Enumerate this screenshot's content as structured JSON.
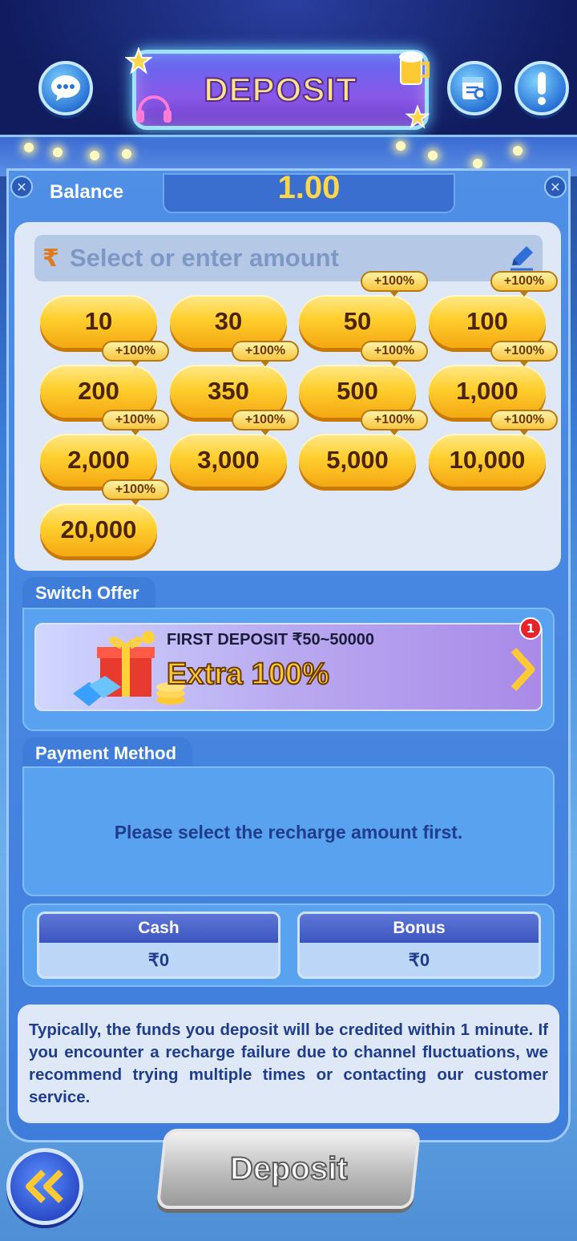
{
  "header": {
    "title": "DEPOSIT",
    "support_icon": "chat-support-icon",
    "records_icon": "records-search-icon",
    "info_icon": "exclamation-icon"
  },
  "balance": {
    "label": "Balance",
    "value": "1.00"
  },
  "amount_input": {
    "currency_symbol": "₹",
    "placeholder": "Select or enter amount"
  },
  "amounts": [
    {
      "label": "10",
      "badge": ""
    },
    {
      "label": "30",
      "badge": ""
    },
    {
      "label": "50",
      "badge": "+100%"
    },
    {
      "label": "100",
      "badge": "+100%"
    },
    {
      "label": "200",
      "badge": "+100%"
    },
    {
      "label": "350",
      "badge": "+100%"
    },
    {
      "label": "500",
      "badge": "+100%"
    },
    {
      "label": "1,000",
      "badge": "+100%"
    },
    {
      "label": "2,000",
      "badge": "+100%"
    },
    {
      "label": "3,000",
      "badge": "+100%"
    },
    {
      "label": "5,000",
      "badge": "+100%"
    },
    {
      "label": "10,000",
      "badge": "+100%"
    },
    {
      "label": "20,000",
      "badge": "+100%"
    }
  ],
  "offer": {
    "tab_label": "Switch Offer",
    "title": "FIRST DEPOSIT  ₹50~50000",
    "headline": "Extra 100%",
    "notification_count": "1"
  },
  "payment": {
    "tab_label": "Payment Method",
    "message": "Please select the recharge amount first."
  },
  "wallets": {
    "cash_label": "Cash",
    "cash_value": "₹0",
    "bonus_label": "Bonus",
    "bonus_value": "₹0"
  },
  "note": "Typically, the funds you deposit will be credited within 1 minute. If you encounter a recharge failure due to channel fluctuations, we recommend trying multiple times or contacting our customer service.",
  "deposit_button": "Deposit",
  "colors": {
    "gold": "#ffcf2e",
    "panel_blue": "#3f7ddb",
    "text_dark_blue": "#1f3d8a"
  }
}
